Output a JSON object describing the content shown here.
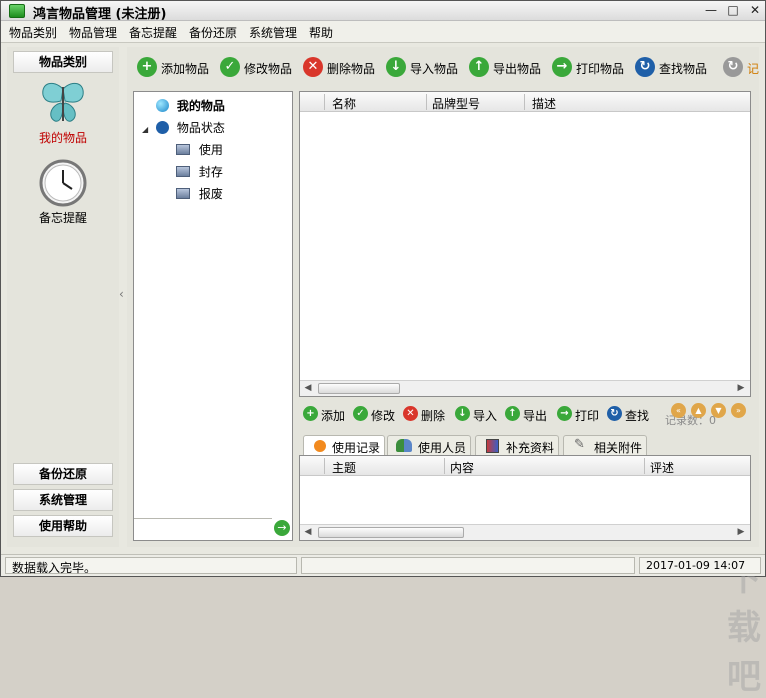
{
  "window": {
    "title": "鸿言物品管理 (未注册)"
  },
  "menu": [
    "物品类别",
    "物品管理",
    "备忘提醒",
    "备份还原",
    "系统管理",
    "帮助"
  ],
  "leftnav": {
    "top_label": "物品类别",
    "item1": "我的物品",
    "item2": "备忘提醒",
    "bottom": [
      "备份还原",
      "系统管理",
      "使用帮助"
    ]
  },
  "toolbar": {
    "add": "添加物品",
    "edit": "修改物品",
    "delete": "删除物品",
    "import": "导入物品",
    "export": "导出物品",
    "print": "打印物品",
    "find": "查找物品",
    "more": "记"
  },
  "tree": {
    "root": "我的物品",
    "status": "物品状态",
    "children": [
      "使用",
      "封存",
      "报废"
    ]
  },
  "grid": {
    "columns": [
      "名称",
      "品牌型号",
      "描述"
    ]
  },
  "subtoolbar": {
    "add": "添加",
    "edit": "修改",
    "delete": "删除",
    "import": "导入",
    "export": "导出",
    "print": "打印",
    "find": "查找",
    "record_count": "记录数：0"
  },
  "tabs": [
    "使用记录",
    "使用人员",
    "补充资料",
    "相关附件"
  ],
  "grid2": {
    "columns": [
      "主题",
      "内容",
      "评述"
    ]
  },
  "status": {
    "message": "数据载入完毕。",
    "datetime": "2017-01-09 14:07"
  },
  "watermark": "下载吧",
  "colors": {
    "green": "#3aa83a",
    "red": "#d9362b",
    "blue": "#1f5fa8",
    "selected_red": "#c00000"
  }
}
